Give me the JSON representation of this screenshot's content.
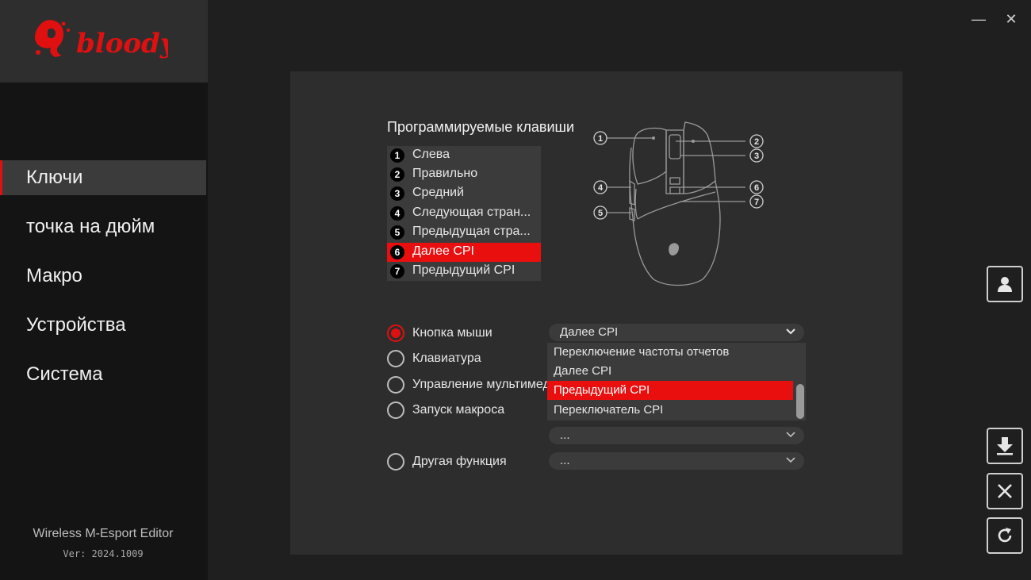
{
  "window": {
    "minimize_glyph": "—",
    "close_glyph": "✕"
  },
  "brand": {
    "logo_text": "bloody",
    "logo_color": "#e01010"
  },
  "sidebar": {
    "items": [
      {
        "label": "Ключи",
        "active": true
      },
      {
        "label": "точка на дюйм",
        "active": false
      },
      {
        "label": "Макро",
        "active": false
      },
      {
        "label": "Устройства",
        "active": false
      },
      {
        "label": "Система",
        "active": false
      }
    ],
    "app_name": "Wireless M-Esport Editor",
    "version": "Ver: 2024.1009"
  },
  "keys": {
    "title": "Программируемые клавиши",
    "items": [
      {
        "num": "1",
        "label": "Слева"
      },
      {
        "num": "2",
        "label": "Правильно"
      },
      {
        "num": "3",
        "label": "Средний"
      },
      {
        "num": "4",
        "label": "Следующая стран..."
      },
      {
        "num": "5",
        "label": "Предыдущая стра..."
      },
      {
        "num": "6",
        "label": "Далее CPI"
      },
      {
        "num": "7",
        "label": "Предыдущий CPI"
      }
    ],
    "selected_index": 5
  },
  "diagram": {
    "callouts": [
      "1",
      "2",
      "3",
      "4",
      "5",
      "6",
      "7"
    ]
  },
  "functions": {
    "options": [
      {
        "label": "Кнопка мыши",
        "checked": true
      },
      {
        "label": "Клавиатура",
        "checked": false
      },
      {
        "label": "Управление мультимед",
        "checked": false
      },
      {
        "label": "Запуск макроса",
        "checked": false
      },
      {
        "label": "Другая функция",
        "checked": false
      }
    ],
    "mouse_button_select": "Далее CPI",
    "macro_select": "...",
    "other_select": "..."
  },
  "dropdown": {
    "items": [
      "Переключение частоты отчетов",
      "Далее CPI",
      "Предыдущий CPI",
      "Переключатель CPI"
    ],
    "highlighted_index": 2
  },
  "tools": {
    "profile_icon": "user-icon",
    "download_icon": "download-icon",
    "reset_icon": "close-icon",
    "refresh_icon": "refresh-icon"
  },
  "colors": {
    "accent": "#e01010",
    "highlight": "#ea0f0f"
  }
}
